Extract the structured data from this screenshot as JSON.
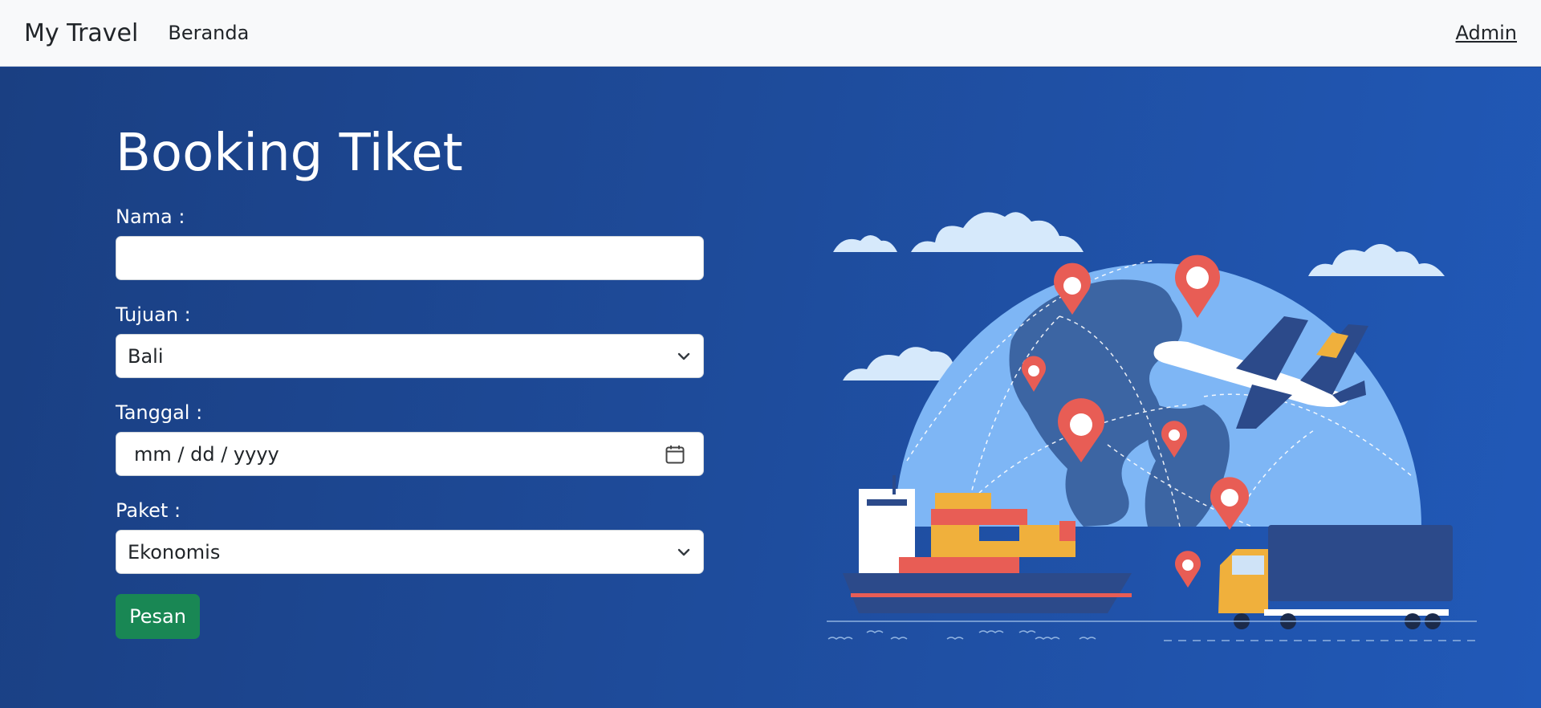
{
  "navbar": {
    "brand": "My Travel",
    "home_link": "Beranda",
    "admin_link": "Admin"
  },
  "form": {
    "title": "Booking Tiket",
    "nama_label": "Nama :",
    "nama_value": "",
    "tujuan_label": "Tujuan :",
    "tujuan_value": "Bali",
    "tanggal_label": "Tanggal :",
    "tanggal_placeholder": "mm / dd / yyyy",
    "paket_label": "Paket :",
    "paket_value": "Ekonomis",
    "submit_label": "Pesan"
  },
  "colors": {
    "hero_bg": "#1e4b9a",
    "submit_button": "#198754",
    "navbar_bg": "#f8f9fa"
  },
  "illustration": {
    "icons": [
      "globe-icon",
      "airplane-icon",
      "cargo-ship-icon",
      "truck-icon",
      "map-pin-icon",
      "cloud-icon"
    ]
  }
}
